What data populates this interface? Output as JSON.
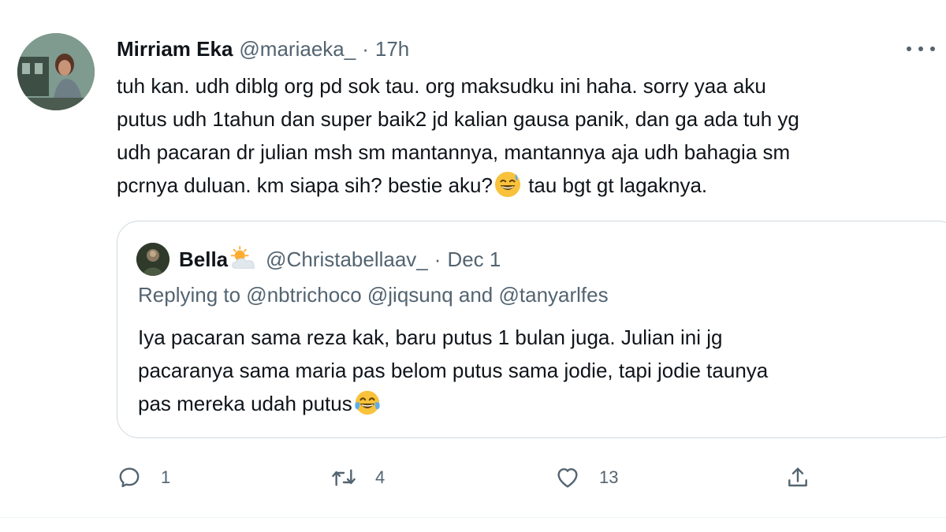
{
  "tweet": {
    "author_name": "Mirriam Eka",
    "author_handle": "@mariaeka_",
    "separator": "·",
    "time": "17h",
    "body_lines": [
      "tuh kan. udh diblg org pd sok tau. org maksudku ini haha. sorry yaa aku",
      "putus udh 1tahun dan super baik2 jd kalian gausa panik, dan ga ada tuh yg",
      "udh pacaran dr julian msh sm mantannya, mantannya aja udh bahagia sm",
      "pcrnya duluan. km siapa sih? bestie aku?",
      "tau bgt gt lagaknya."
    ],
    "emoji_inline": "grinning-face-with-sweat"
  },
  "quoted_tweet": {
    "author_name": "Bella",
    "name_emoji": "sun-behind-cloud",
    "author_handle": "@Christabellaav_",
    "separator": "·",
    "date": "Dec 1",
    "replying_to": "Replying to @nbtrichoco @jiqsunq and @tanyarlfes",
    "body_lines": [
      "Iya pacaran sama reza kak, baru putus 1 bulan juga. Julian ini jg",
      "pacaranya sama maria pas belom putus sama jodie, tapi jodie taunya",
      "pas mereka udah putus"
    ],
    "emoji_end": "face-with-tears-of-joy"
  },
  "actions": {
    "reply_count": "1",
    "retweet_count": "4",
    "like_count": "13"
  },
  "icons": {
    "more": "more-dots-icon",
    "reply": "reply-icon",
    "retweet": "retweet-icon",
    "like": "heart-icon",
    "share": "share-icon"
  },
  "colors": {
    "text_primary": "#0f1419",
    "text_secondary": "#536471",
    "border": "#cfd9de",
    "emoji_yellow": "#f9c23c"
  }
}
